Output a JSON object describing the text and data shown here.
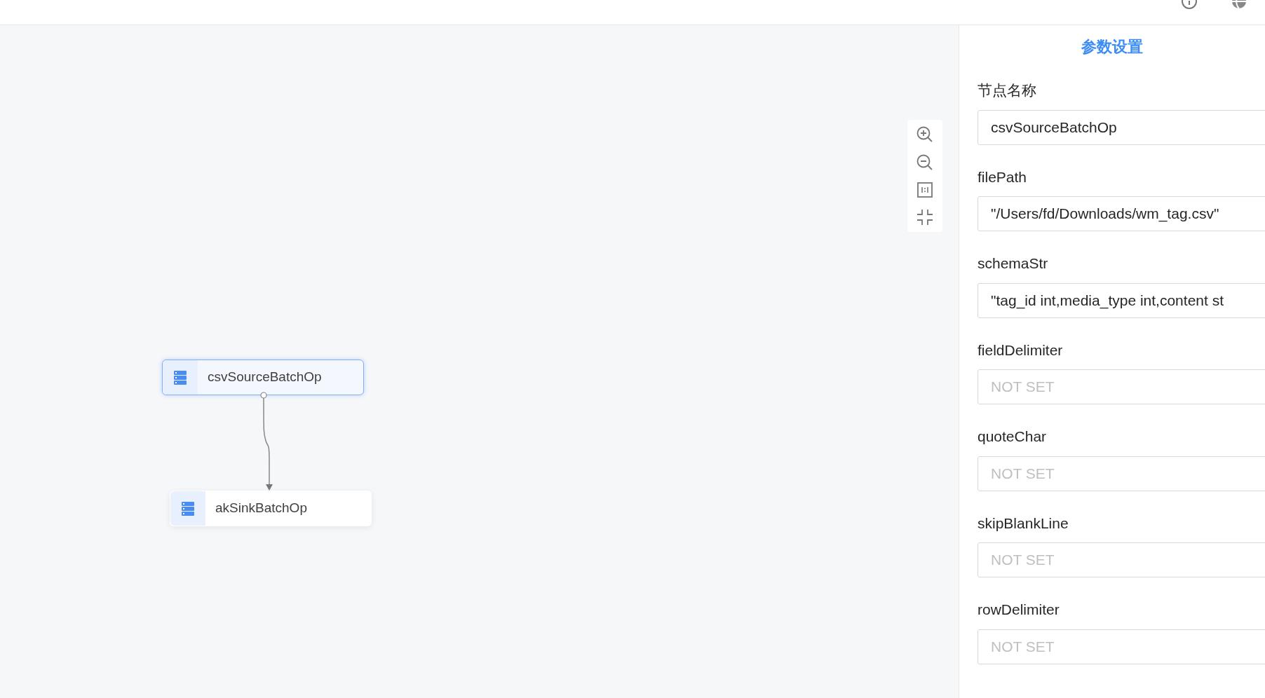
{
  "canvas": {
    "nodes": [
      {
        "label": "csvSourceBatchOp",
        "selected": true
      },
      {
        "label": "akSinkBatchOp",
        "selected": false
      }
    ]
  },
  "panel": {
    "title": "参数设置",
    "fields": [
      {
        "label": "节点名称",
        "value": "csvSourceBatchOp"
      },
      {
        "label": "filePath",
        "value": "\"/Users/fd/Downloads/wm_tag.csv\""
      },
      {
        "label": "schemaStr",
        "value": "\"tag_id int,media_type int,content st"
      },
      {
        "label": "fieldDelimiter",
        "placeholder": "NOT SET"
      },
      {
        "label": "quoteChar",
        "placeholder": "NOT SET"
      },
      {
        "label": "skipBlankLine",
        "placeholder": "NOT SET"
      },
      {
        "label": "rowDelimiter",
        "placeholder": "NOT SET"
      }
    ]
  }
}
